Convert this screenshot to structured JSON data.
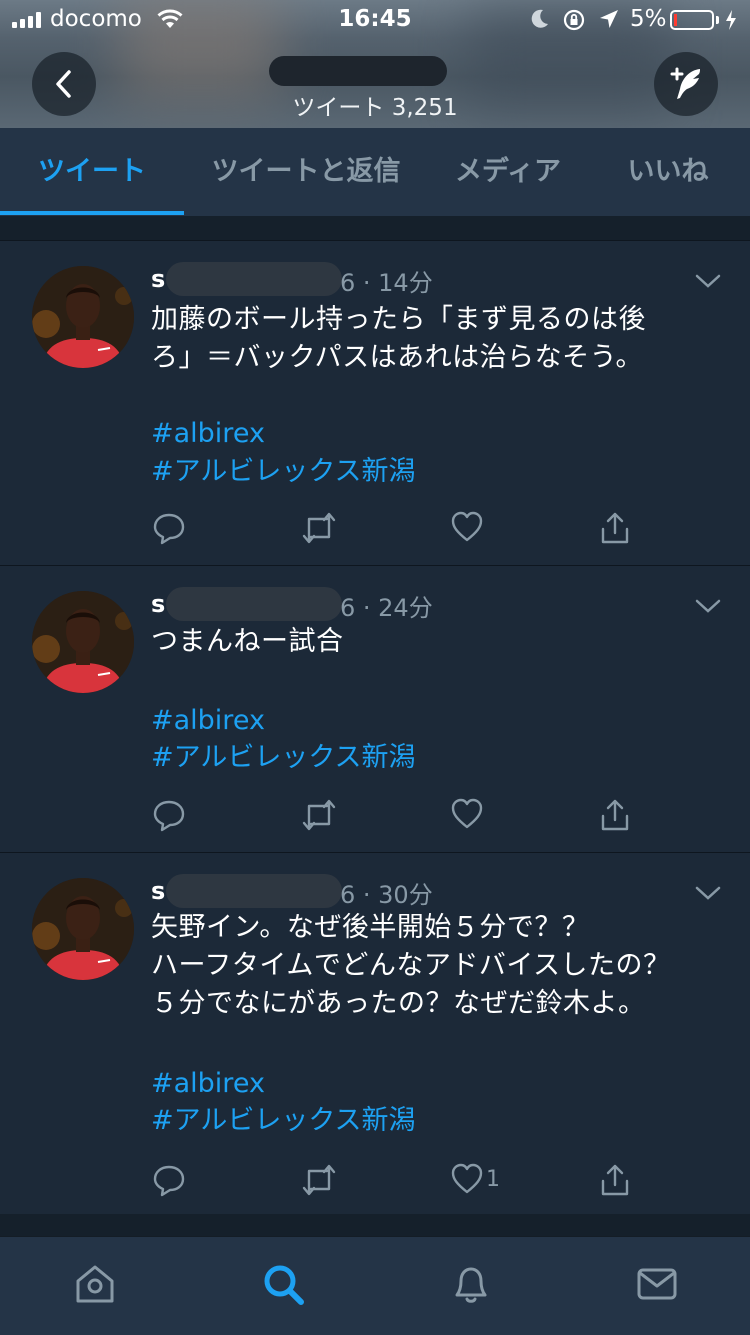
{
  "status_bar": {
    "carrier": "docomo",
    "time": "16:45",
    "battery_percent": "5%"
  },
  "header": {
    "tweet_count": "ツイート 3,251",
    "back_icon": "chevron-left-icon",
    "compose_icon": "compose-tweet-icon"
  },
  "tabs": [
    {
      "label": "ツイート",
      "active": true
    },
    {
      "label": "ツイートと返信",
      "active": false
    },
    {
      "label": "メディア",
      "active": false
    },
    {
      "label": "いいね",
      "active": false
    }
  ],
  "tweets": [
    {
      "name_initial": "s",
      "time": "6 · 14分",
      "text_lines": [
        "加藤のボール持ったら「まず見るのは後",
        "ろ」＝バックパスはあれは治らなそう。"
      ],
      "hashtags": [
        "#albirex",
        "#アルビレックス新潟"
      ],
      "like_count": ""
    },
    {
      "name_initial": "s",
      "time": "6 · 24分",
      "text_lines": [
        "つまんねー試合"
      ],
      "hashtags": [
        "#albirex",
        "#アルビレックス新潟"
      ],
      "like_count": ""
    },
    {
      "name_initial": "s",
      "time": "6 · 30分",
      "text_lines": [
        "矢野イン。なぜ後半開始５分で？？",
        "ハーフタイムでどんなアドバイスしたの？",
        "５分でなにがあったの？なぜだ鈴木よ。"
      ],
      "hashtags": [
        "#albirex",
        "#アルビレックス新潟"
      ],
      "like_count": "1"
    }
  ],
  "bottom_nav": [
    "home-icon",
    "search-icon",
    "notifications-icon",
    "messages-icon"
  ],
  "colors": {
    "accent": "#1da1f2",
    "background": "#15202b",
    "card": "#1c2938",
    "bar": "#243447",
    "secondary_text": "#8899a6"
  }
}
